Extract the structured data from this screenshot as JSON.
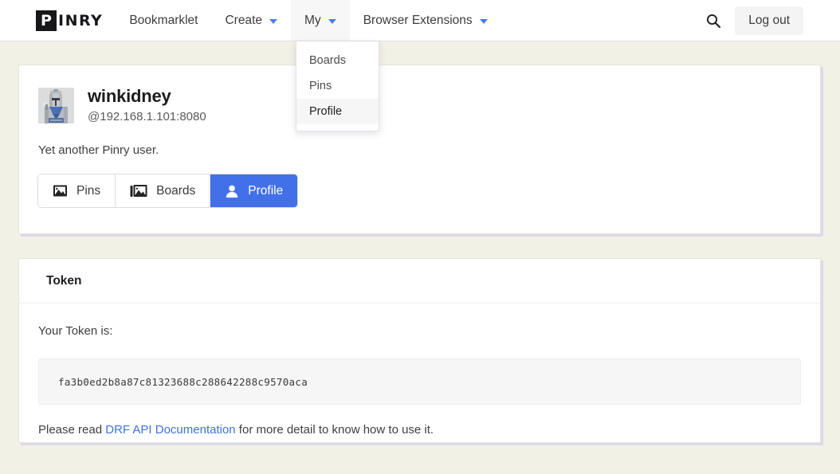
{
  "theme": {
    "page_bg": "#f2f1e6",
    "accent_blue": "#4270e8",
    "link_blue": "#3e72e0",
    "card_bg": "#ffffff",
    "shadow": "#dcd9ea"
  },
  "navbar": {
    "logo_first": "P",
    "logo_rest": "INRY",
    "logo_full": "PINRY",
    "items": [
      {
        "label": "Bookmarklet",
        "has_caret": false,
        "active": false
      },
      {
        "label": "Create",
        "has_caret": true,
        "active": false
      },
      {
        "label": "My",
        "has_caret": true,
        "active": true
      },
      {
        "label": "Browser Extensions",
        "has_caret": true,
        "active": false
      }
    ],
    "search_icon": "search-icon",
    "logout_label": "Log out"
  },
  "dropdown": {
    "open_for": "My",
    "items": [
      {
        "label": "Boards",
        "highlighted": false
      },
      {
        "label": "Pins",
        "highlighted": false
      },
      {
        "label": "Profile",
        "highlighted": true
      }
    ]
  },
  "profile": {
    "avatar_alt": "pixel-art knight avatar",
    "username": "winkidney",
    "handle": "@192.168.1.101:8080",
    "bio": "Yet another Pinry user.",
    "tabs": [
      {
        "label": "Pins",
        "icon": "image-icon",
        "active": false
      },
      {
        "label": "Boards",
        "icon": "images-stack-icon",
        "active": false
      },
      {
        "label": "Profile",
        "icon": "person-icon",
        "active": true
      }
    ]
  },
  "token_card": {
    "header": "Token",
    "intro": "Your Token is:",
    "token": "fa3b0ed2b8a87c81323688c288642288c9570aca",
    "footer_prefix": "Please read ",
    "footer_link": "DRF API Documentation",
    "footer_suffix": " for more detail to know how to use it."
  }
}
